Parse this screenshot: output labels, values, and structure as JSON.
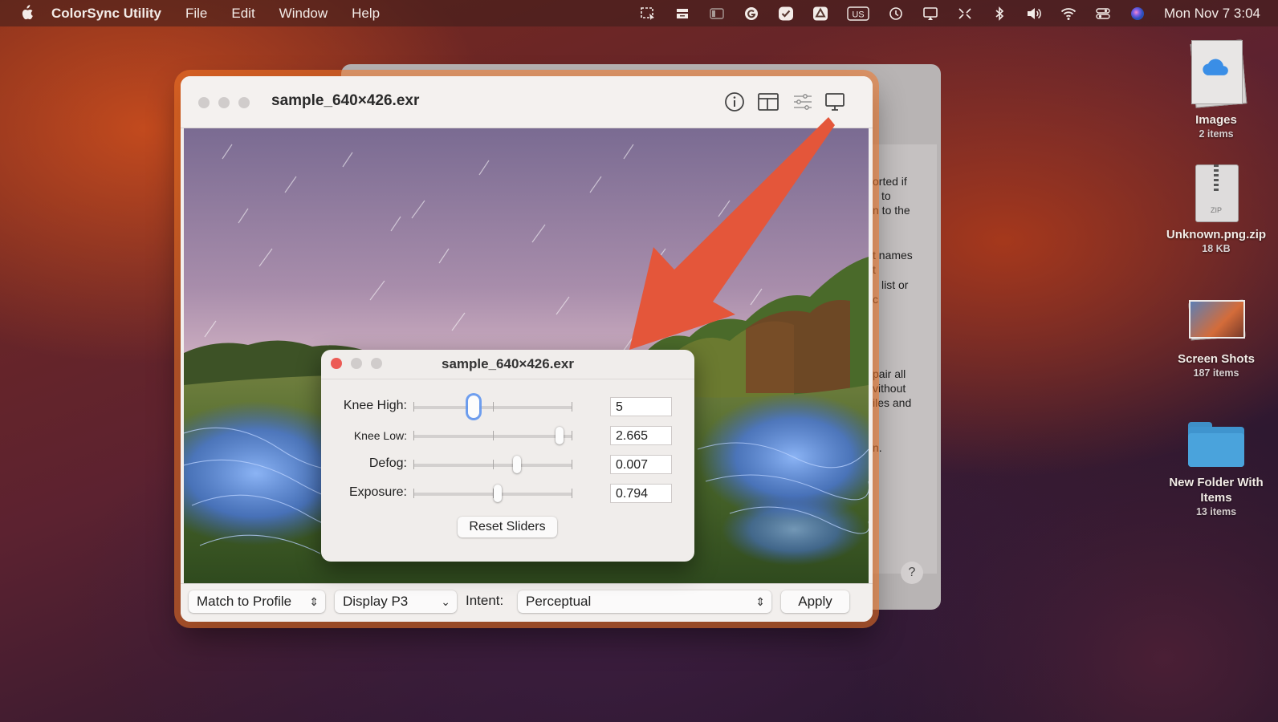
{
  "menubar": {
    "app_name": "ColorSync Utility",
    "menus": [
      "File",
      "Edit",
      "Window",
      "Help"
    ],
    "input_source": "US",
    "clock": "Mon Nov 7  3:04"
  },
  "desktop": {
    "items": [
      {
        "name": "Images",
        "detail": "2 items",
        "icon": "icloud-stack-icon"
      },
      {
        "name": "Unknown.png.zip",
        "detail": "18 KB",
        "icon": "zip-file-icon"
      },
      {
        "name": "Screen Shots",
        "detail": "187 items",
        "icon": "screenshots-stack-icon"
      },
      {
        "name": "New Folder With Items",
        "detail": "13 items",
        "icon": "folder-icon"
      }
    ]
  },
  "background_window": {
    "text_fragments": [
      "orted if",
      "to",
      "n to the",
      "t names",
      "t",
      "list or",
      "c",
      "pair all",
      "vithout",
      "iles and",
      "n."
    ],
    "help_label": "?"
  },
  "main_window": {
    "title": "sample_640×426.exr",
    "toolbar_icons": [
      "info-icon",
      "layout-icon",
      "sliders-icon",
      "display-icon"
    ],
    "bottom": {
      "action_popup": "Match to Profile",
      "profile_popup": "Display P3",
      "intent_label": "Intent:",
      "intent_popup": "Perceptual",
      "apply_label": "Apply"
    }
  },
  "exr_panel": {
    "title": "sample_640×426.exr",
    "sliders": [
      {
        "label": "Knee High:",
        "value": "5",
        "fraction": 0.38
      },
      {
        "label": "Knee Low:",
        "value": "2.665",
        "fraction": 0.92
      },
      {
        "label": "Defog:",
        "value": "0.007",
        "fraction": 0.65
      },
      {
        "label": "Exposure:",
        "value": "0.794",
        "fraction": 0.53
      }
    ],
    "reset_label": "Reset Sliders"
  },
  "colors": {
    "close_red": "#ec5b55",
    "annotation_arrow": "#e4563a",
    "focus_ring": "#6096f0"
  }
}
